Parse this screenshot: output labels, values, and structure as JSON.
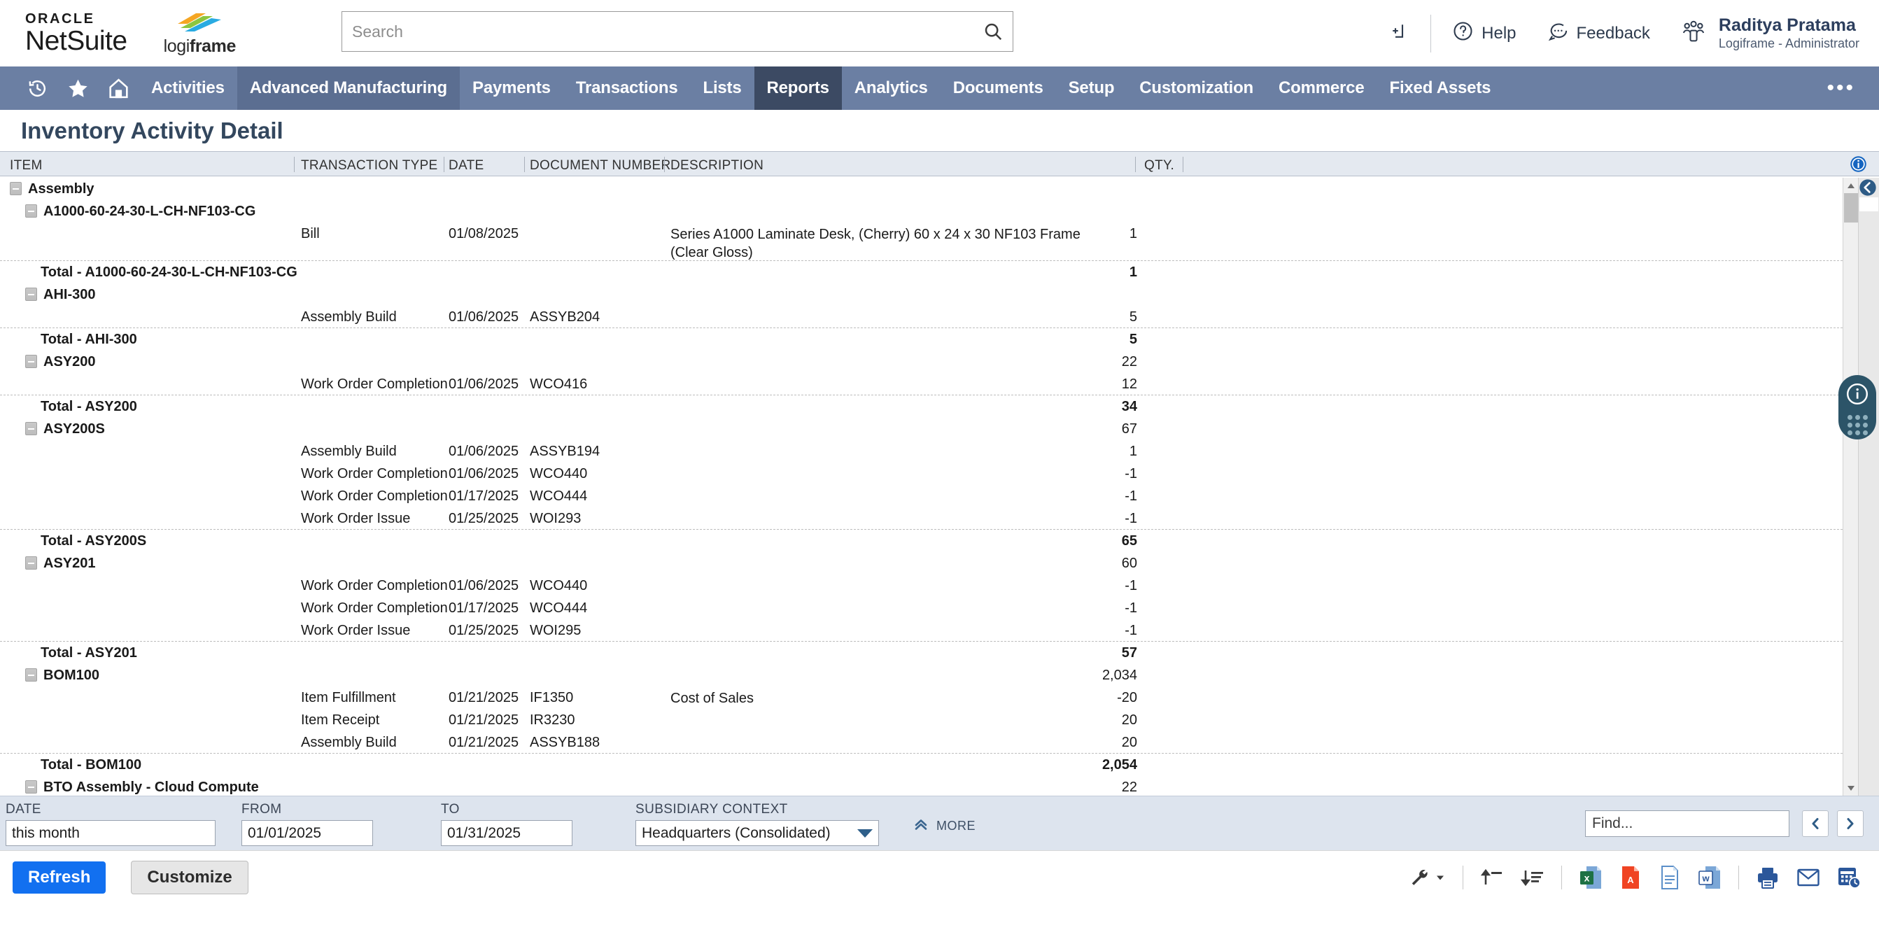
{
  "header": {
    "brand_oracle_top": "ORACLE",
    "brand_oracle_main": "NetSuite",
    "partner_logo_prefix": "logi",
    "partner_logo_suffix": "frame",
    "search_placeholder": "Search",
    "search_value": "",
    "help_label": "Help",
    "feedback_label": "Feedback",
    "user_name": "Raditya Pratama",
    "user_role": "Logiframe - Administrator"
  },
  "nav": {
    "items": [
      {
        "label": "Activities",
        "state": "normal"
      },
      {
        "label": "Advanced Manufacturing",
        "state": "hover"
      },
      {
        "label": "Payments",
        "state": "normal"
      },
      {
        "label": "Transactions",
        "state": "normal"
      },
      {
        "label": "Lists",
        "state": "normal"
      },
      {
        "label": "Reports",
        "state": "active"
      },
      {
        "label": "Analytics",
        "state": "normal"
      },
      {
        "label": "Documents",
        "state": "normal"
      },
      {
        "label": "Setup",
        "state": "normal"
      },
      {
        "label": "Customization",
        "state": "normal"
      },
      {
        "label": "Commerce",
        "state": "normal"
      },
      {
        "label": "Fixed Assets",
        "state": "normal"
      }
    ],
    "overflow_label": "•••"
  },
  "page": {
    "title": "Inventory Activity Detail"
  },
  "table": {
    "columns": [
      "ITEM",
      "TRANSACTION TYPE",
      "DATE",
      "DOCUMENT NUMBER",
      "DESCRIPTION",
      "QTY."
    ],
    "rows": [
      {
        "kind": "group1",
        "item": "Assembly",
        "type": "",
        "date": "",
        "doc": "",
        "desc": "",
        "qty": ""
      },
      {
        "kind": "group2",
        "item": "A1000-60-24-30-L-CH-NF103-CG",
        "type": "",
        "date": "",
        "doc": "",
        "desc": "",
        "qty": ""
      },
      {
        "kind": "detail2",
        "item": "",
        "type": "Bill",
        "date": "01/08/2025",
        "doc": "",
        "desc": "Series A1000 Laminate Desk, (Cherry) 60 x 24 x 30 NF103 Frame (Clear Gloss)",
        "qty": "1"
      },
      {
        "kind": "total",
        "item": "Total - A1000-60-24-30-L-CH-NF103-CG",
        "type": "",
        "date": "",
        "doc": "",
        "desc": "",
        "qty": "1"
      },
      {
        "kind": "group2",
        "item": "AHI-300",
        "type": "",
        "date": "",
        "doc": "",
        "desc": "",
        "qty": ""
      },
      {
        "kind": "detail",
        "item": "",
        "type": "Assembly Build",
        "date": "01/06/2025",
        "doc": "ASSYB204",
        "desc": "",
        "qty": "5"
      },
      {
        "kind": "total",
        "item": "Total - AHI-300",
        "type": "",
        "date": "",
        "doc": "",
        "desc": "",
        "qty": "5"
      },
      {
        "kind": "group2",
        "item": "ASY200",
        "type": "",
        "date": "",
        "doc": "",
        "desc": "",
        "qty": "22"
      },
      {
        "kind": "detail",
        "item": "",
        "type": "Work Order Completion",
        "date": "01/06/2025",
        "doc": "WCO416",
        "desc": "",
        "qty": "12"
      },
      {
        "kind": "total",
        "item": "Total - ASY200",
        "type": "",
        "date": "",
        "doc": "",
        "desc": "",
        "qty": "34"
      },
      {
        "kind": "group2",
        "item": "ASY200S",
        "type": "",
        "date": "",
        "doc": "",
        "desc": "",
        "qty": "67"
      },
      {
        "kind": "detail",
        "item": "",
        "type": "Assembly Build",
        "date": "01/06/2025",
        "doc": "ASSYB194",
        "desc": "",
        "qty": "1"
      },
      {
        "kind": "detail",
        "item": "",
        "type": "Work Order Completion",
        "date": "01/06/2025",
        "doc": "WCO440",
        "desc": "",
        "qty": "-1"
      },
      {
        "kind": "detail",
        "item": "",
        "type": "Work Order Completion",
        "date": "01/17/2025",
        "doc": "WCO444",
        "desc": "",
        "qty": "-1"
      },
      {
        "kind": "detail",
        "item": "",
        "type": "Work Order Issue",
        "date": "01/25/2025",
        "doc": "WOI293",
        "desc": "",
        "qty": "-1"
      },
      {
        "kind": "total",
        "item": "Total - ASY200S",
        "type": "",
        "date": "",
        "doc": "",
        "desc": "",
        "qty": "65"
      },
      {
        "kind": "group2",
        "item": "ASY201",
        "type": "",
        "date": "",
        "doc": "",
        "desc": "",
        "qty": "60"
      },
      {
        "kind": "detail",
        "item": "",
        "type": "Work Order Completion",
        "date": "01/06/2025",
        "doc": "WCO440",
        "desc": "",
        "qty": "-1"
      },
      {
        "kind": "detail",
        "item": "",
        "type": "Work Order Completion",
        "date": "01/17/2025",
        "doc": "WCO444",
        "desc": "",
        "qty": "-1"
      },
      {
        "kind": "detail",
        "item": "",
        "type": "Work Order Issue",
        "date": "01/25/2025",
        "doc": "WOI295",
        "desc": "",
        "qty": "-1"
      },
      {
        "kind": "total",
        "item": "Total - ASY201",
        "type": "",
        "date": "",
        "doc": "",
        "desc": "",
        "qty": "57"
      },
      {
        "kind": "group2",
        "item": "BOM100",
        "type": "",
        "date": "",
        "doc": "",
        "desc": "",
        "qty": "2,034"
      },
      {
        "kind": "detail",
        "item": "",
        "type": "Item Fulfillment",
        "date": "01/21/2025",
        "doc": "IF1350",
        "desc": "Cost of Sales",
        "qty": "-20"
      },
      {
        "kind": "detail",
        "item": "",
        "type": "Item Receipt",
        "date": "01/21/2025",
        "doc": "IR3230",
        "desc": "",
        "qty": "20"
      },
      {
        "kind": "detail",
        "item": "",
        "type": "Assembly Build",
        "date": "01/21/2025",
        "doc": "ASSYB188",
        "desc": "",
        "qty": "20"
      },
      {
        "kind": "total",
        "item": "Total - BOM100",
        "type": "",
        "date": "",
        "doc": "",
        "desc": "",
        "qty": "2,054"
      },
      {
        "kind": "group2",
        "item": "BTO Assembly - Cloud Compute",
        "type": "",
        "date": "",
        "doc": "",
        "desc": "",
        "qty": "22"
      }
    ]
  },
  "filters": {
    "date_label": "DATE",
    "date_value": "this month",
    "from_label": "FROM",
    "from_value": "01/01/2025",
    "to_label": "TO",
    "to_value": "01/31/2025",
    "subsidiary_label": "SUBSIDIARY CONTEXT",
    "subsidiary_value": "Headquarters (Consolidated)",
    "more_label": "MORE",
    "find_placeholder": "Find...",
    "find_value": ""
  },
  "actions": {
    "refresh_label": "Refresh",
    "customize_label": "Customize"
  },
  "colors": {
    "nav_bg": "#6b7fa3",
    "nav_active": "#3c4a63",
    "nav_hover": "#5b6e91",
    "title_text": "#33475e",
    "primary_button": "#1270f0",
    "filter_bar": "#dde4ee",
    "header_row": "#e4e9f0"
  }
}
